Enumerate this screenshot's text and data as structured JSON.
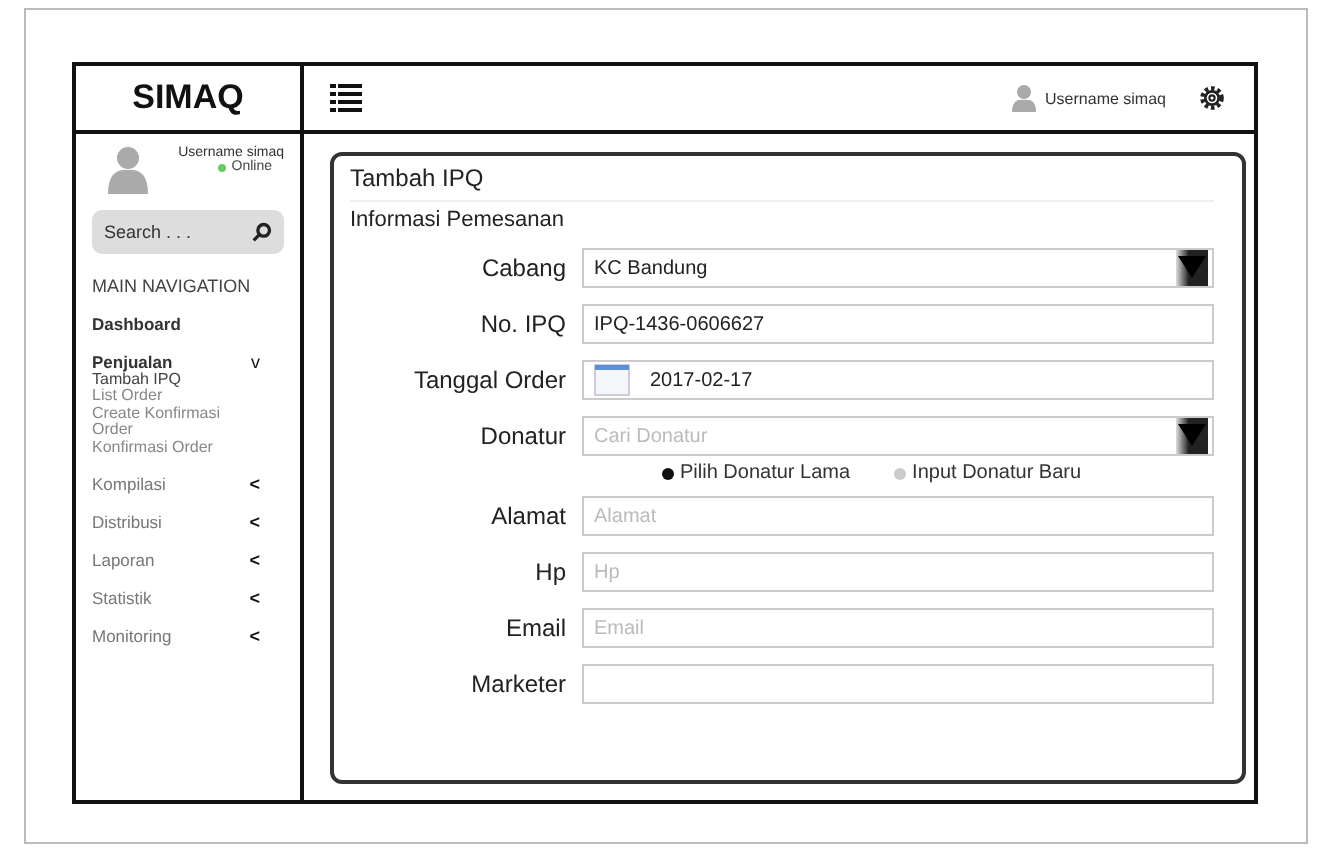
{
  "brand": "SIMAQ",
  "header": {
    "username": "Username simaq"
  },
  "sidebar": {
    "user": {
      "name": "Username simaq",
      "status": "Online"
    },
    "search": {
      "placeholder": "Search . . ."
    },
    "heading": "MAIN NAVIGATION",
    "items": [
      {
        "label": "Dashboard",
        "bold": true
      },
      {
        "label": "Penjualan",
        "bold": true,
        "toggle": "v",
        "expanded": true,
        "children": [
          {
            "label": "Tambah IPQ",
            "selected": true
          },
          {
            "label": "List Order",
            "selected": false
          },
          {
            "label": "Create Konfirmasi Order",
            "selected": false
          },
          {
            "label": "Konfirmasi Order",
            "selected": false
          }
        ]
      },
      {
        "label": "Kompilasi",
        "bold": false,
        "toggle": "<",
        "expanded": false
      },
      {
        "label": "Distribusi",
        "bold": false,
        "toggle": "<",
        "expanded": false
      },
      {
        "label": "Laporan",
        "bold": false,
        "toggle": "<",
        "expanded": false
      },
      {
        "label": "Statistik",
        "bold": false,
        "toggle": "<",
        "expanded": false
      },
      {
        "label": "Monitoring",
        "bold": false,
        "toggle": "<",
        "expanded": false
      }
    ]
  },
  "card": {
    "title": "Tambah IPQ",
    "section": "Informasi Pemesanan",
    "fields": [
      {
        "kind": "select",
        "label": "Cabang",
        "value": "KC Bandung"
      },
      {
        "kind": "text",
        "label": "No. IPQ",
        "value": "IPQ-1436-0606627"
      },
      {
        "kind": "date",
        "label": "Tanggal Order",
        "value": "2017-02-17"
      },
      {
        "kind": "select",
        "label": "Donatur",
        "placeholder": "Cari Donatur"
      },
      {
        "kind": "radios",
        "options": [
          {
            "label": "Pilih Donatur Lama",
            "selected": true
          },
          {
            "label": "Input Donatur Baru",
            "selected": false
          }
        ]
      },
      {
        "kind": "text",
        "label": "Alamat",
        "placeholder": "Alamat"
      },
      {
        "kind": "text",
        "label": "Hp",
        "placeholder": "Hp"
      },
      {
        "kind": "text",
        "label": "Email",
        "placeholder": "Email"
      },
      {
        "kind": "text",
        "label": "Marketer"
      }
    ]
  }
}
